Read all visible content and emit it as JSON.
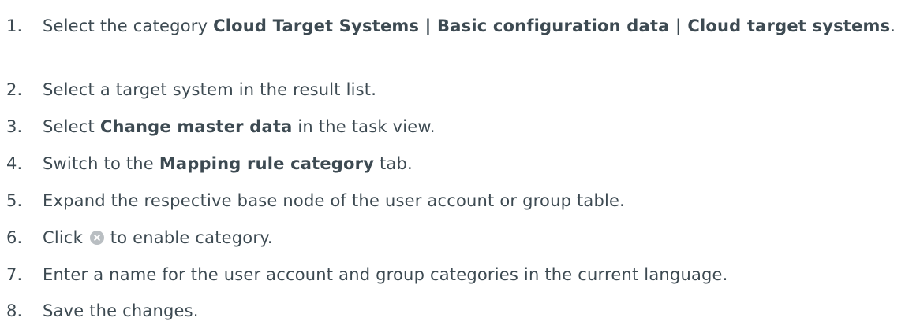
{
  "steps": [
    {
      "number": "1.",
      "prefix": "Select the category ",
      "bold": "Cloud Target Systems | Basic configuration data | Cloud target systems",
      "suffix": "."
    },
    {
      "number": "2.",
      "text": "Select a target system in the result list."
    },
    {
      "number": "3.",
      "prefix": "Select ",
      "bold": "Change master data",
      "suffix": " in the task view."
    },
    {
      "number": "4.",
      "prefix": "Switch to the ",
      "bold": "Mapping rule category",
      "suffix": " tab."
    },
    {
      "number": "5.",
      "text": "Expand the respective base node of the user account or group table."
    },
    {
      "number": "6.",
      "prefix": "Click ",
      "icon": "cancel-circle-icon",
      "suffix": " to enable category."
    },
    {
      "number": "7.",
      "text": "Enter a name for the user account and group categories in the current language."
    },
    {
      "number": "8.",
      "text": "Save the changes."
    }
  ],
  "colors": {
    "text": "#3d4a52",
    "icon_fill": "#b9bec2"
  }
}
